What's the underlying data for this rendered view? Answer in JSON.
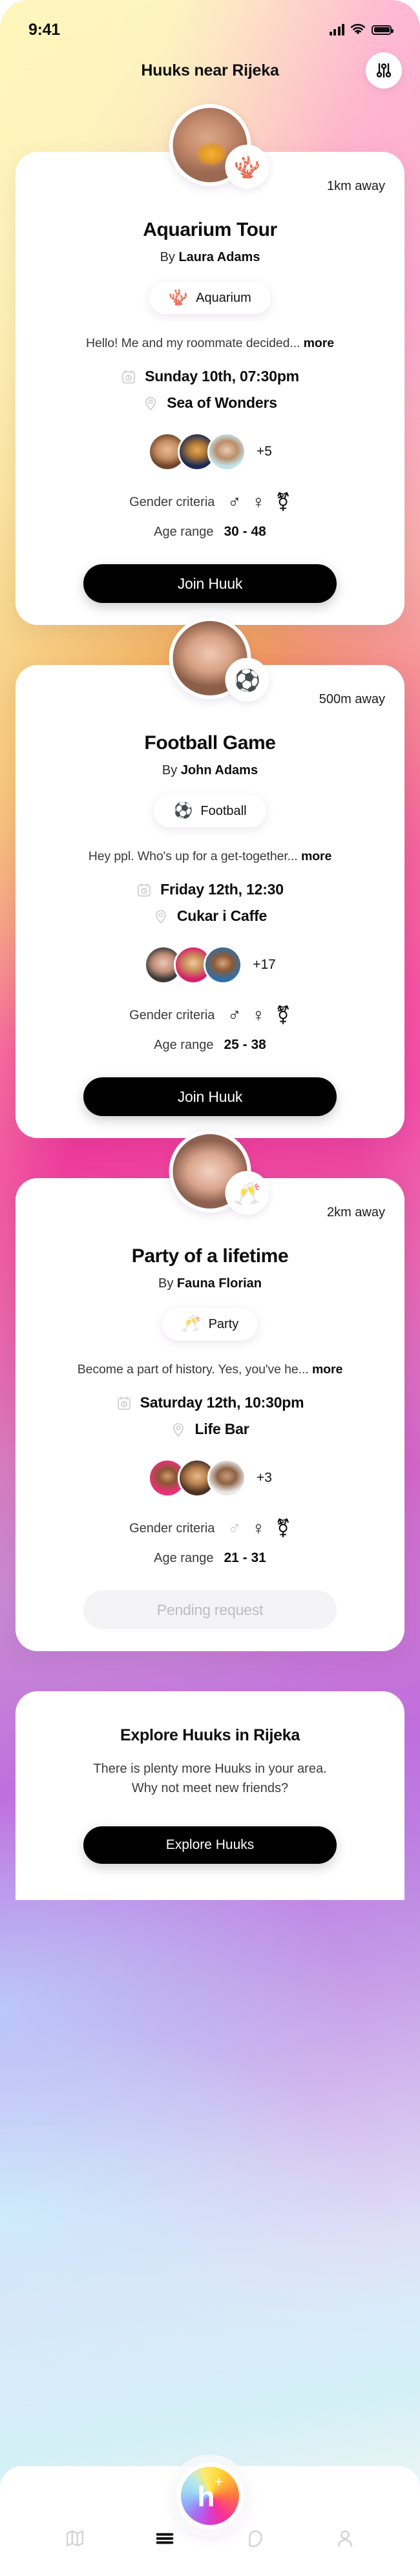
{
  "status_bar": {
    "time": "9:41",
    "signal_icon": "cellular-signal-icon",
    "wifi_icon": "wifi-icon",
    "battery_icon": "battery-icon"
  },
  "header": {
    "title": "Huuks near Rijeka",
    "filter_icon": "sliders-filter-icon"
  },
  "cards": [
    {
      "title": "Aquarium Tour",
      "by_prefix": "By ",
      "host": "Laura Adams",
      "distance": "1km away",
      "category_emoji": "🪸",
      "category_label": "Aquarium",
      "description": "Hello! Me and my roommate decided...",
      "more_label": "more",
      "date": "Sunday 10th, 07:30pm",
      "location": "Sea of Wonders",
      "attendees_more": "+5",
      "gender_label": "Gender criteria",
      "genders": [
        {
          "symbol": "♂",
          "name": "male-gender-icon",
          "active": true
        },
        {
          "symbol": "♀",
          "name": "female-gender-icon",
          "active": true
        },
        {
          "symbol": "⚧",
          "name": "nonbinary-gender-icon",
          "active": true
        }
      ],
      "age_label": "Age range",
      "age_value": "30 - 48",
      "action_label": "Join Huuk",
      "action_state": "active"
    },
    {
      "title": "Football Game",
      "by_prefix": "By ",
      "host": "John Adams",
      "distance": "500m away",
      "category_emoji": "⚽",
      "category_label": "Football",
      "description": "Hey ppl. Who's up for a get-together...",
      "more_label": "more",
      "date": "Friday 12th, 12:30",
      "location": "Cukar i Caffe",
      "attendees_more": "+17",
      "gender_label": "Gender criteria",
      "genders": [
        {
          "symbol": "♂",
          "name": "male-gender-icon",
          "active": true
        },
        {
          "symbol": "♀",
          "name": "female-gender-icon",
          "active": true
        },
        {
          "symbol": "⚧",
          "name": "nonbinary-gender-icon",
          "active": true
        }
      ],
      "age_label": "Age range",
      "age_value": "25 - 38",
      "action_label": "Join Huuk",
      "action_state": "active"
    },
    {
      "title": "Party of a lifetime",
      "by_prefix": "By ",
      "host": "Fauna Florian",
      "distance": "2km away",
      "category_emoji": "🥂",
      "category_label": "Party",
      "description": "Become a part of history. Yes, you've he...",
      "more_label": "more",
      "date": "Saturday 12th, 10:30pm",
      "location": "Life Bar",
      "attendees_more": "+3",
      "gender_label": "Gender criteria",
      "genders": [
        {
          "symbol": "♂",
          "name": "male-gender-icon",
          "active": false
        },
        {
          "symbol": "♀",
          "name": "female-gender-icon",
          "active": true
        },
        {
          "symbol": "⚧",
          "name": "nonbinary-gender-icon",
          "active": true
        }
      ],
      "age_label": "Age range",
      "age_value": "21 - 31",
      "action_label": "Pending request",
      "action_state": "pending"
    }
  ],
  "explore": {
    "title": "Explore Huuks in Rijeka",
    "subtitle_line1": "There is plenty more Huuks in your area.",
    "subtitle_line2": "Why not meet new friends?",
    "button_label": "Explore Huuks"
  },
  "tabbar": {
    "items": [
      {
        "icon": "map-icon",
        "active": false
      },
      {
        "icon": "list-menu-icon",
        "active": true
      },
      {
        "icon": "chat-bubble-icon",
        "active": false
      },
      {
        "icon": "profile-person-icon",
        "active": false
      }
    ],
    "fab": {
      "icon": "huuk-plus-logo",
      "letter": "h",
      "superscript": "+"
    }
  },
  "colors": {
    "accent_dark": "#000000",
    "pending_bg": "#f4f4f6",
    "pending_text": "#bcbcc2",
    "card_bg": "#ffffff",
    "text_primary": "#0d0d0d",
    "text_secondary": "#3a3a3a",
    "gender_inactive": "#c6c6c6"
  }
}
